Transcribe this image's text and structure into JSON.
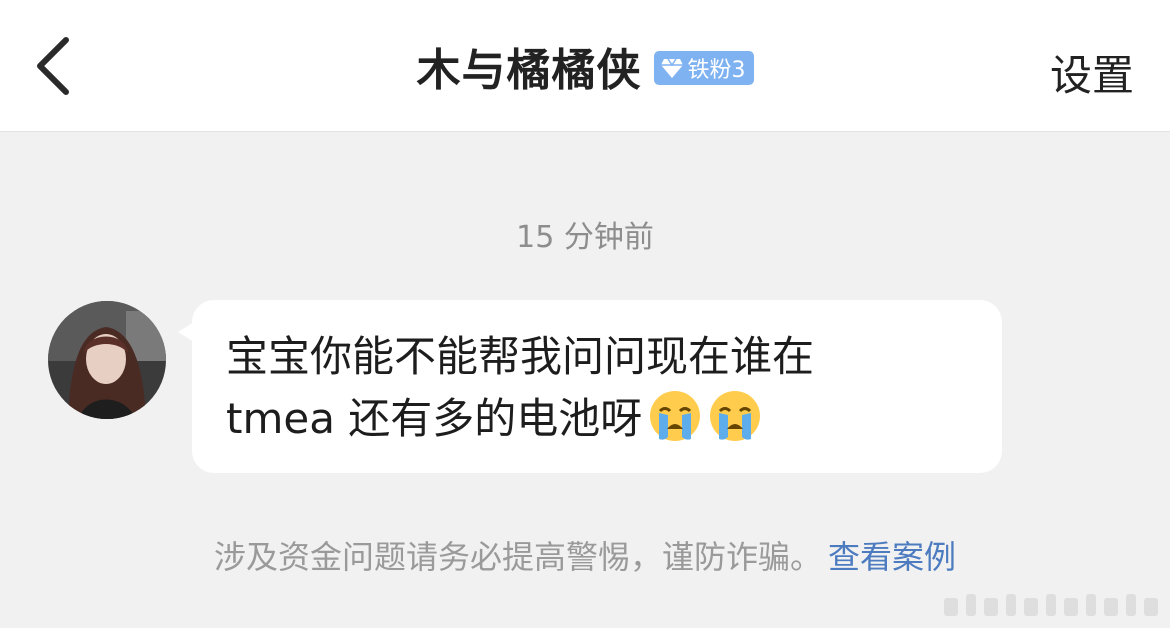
{
  "header": {
    "title": "木与橘橘侠",
    "badge": {
      "label": "铁粉3",
      "icon": "diamond-icon",
      "color": "#7fb2f1"
    },
    "back_icon": "chevron-left-icon",
    "settings_label": "设置"
  },
  "chat": {
    "timestamp": "15 分钟前",
    "messages": [
      {
        "sender": "other",
        "avatar": "avatar",
        "line1": "宝宝你能不能帮我问问现在谁在",
        "line2": "tmea 还有多的电池呀",
        "emojis": [
          "loudly-crying-face-icon",
          "loudly-crying-face-icon"
        ]
      }
    ]
  },
  "notice": {
    "text": "涉及资金问题请务必提高警惕，谨防诈骗。",
    "link_label": "查看案例",
    "link_color": "#4c7bc0"
  },
  "colors": {
    "background": "#f1f1f1",
    "bubble": "#ffffff",
    "header": "#ffffff"
  }
}
